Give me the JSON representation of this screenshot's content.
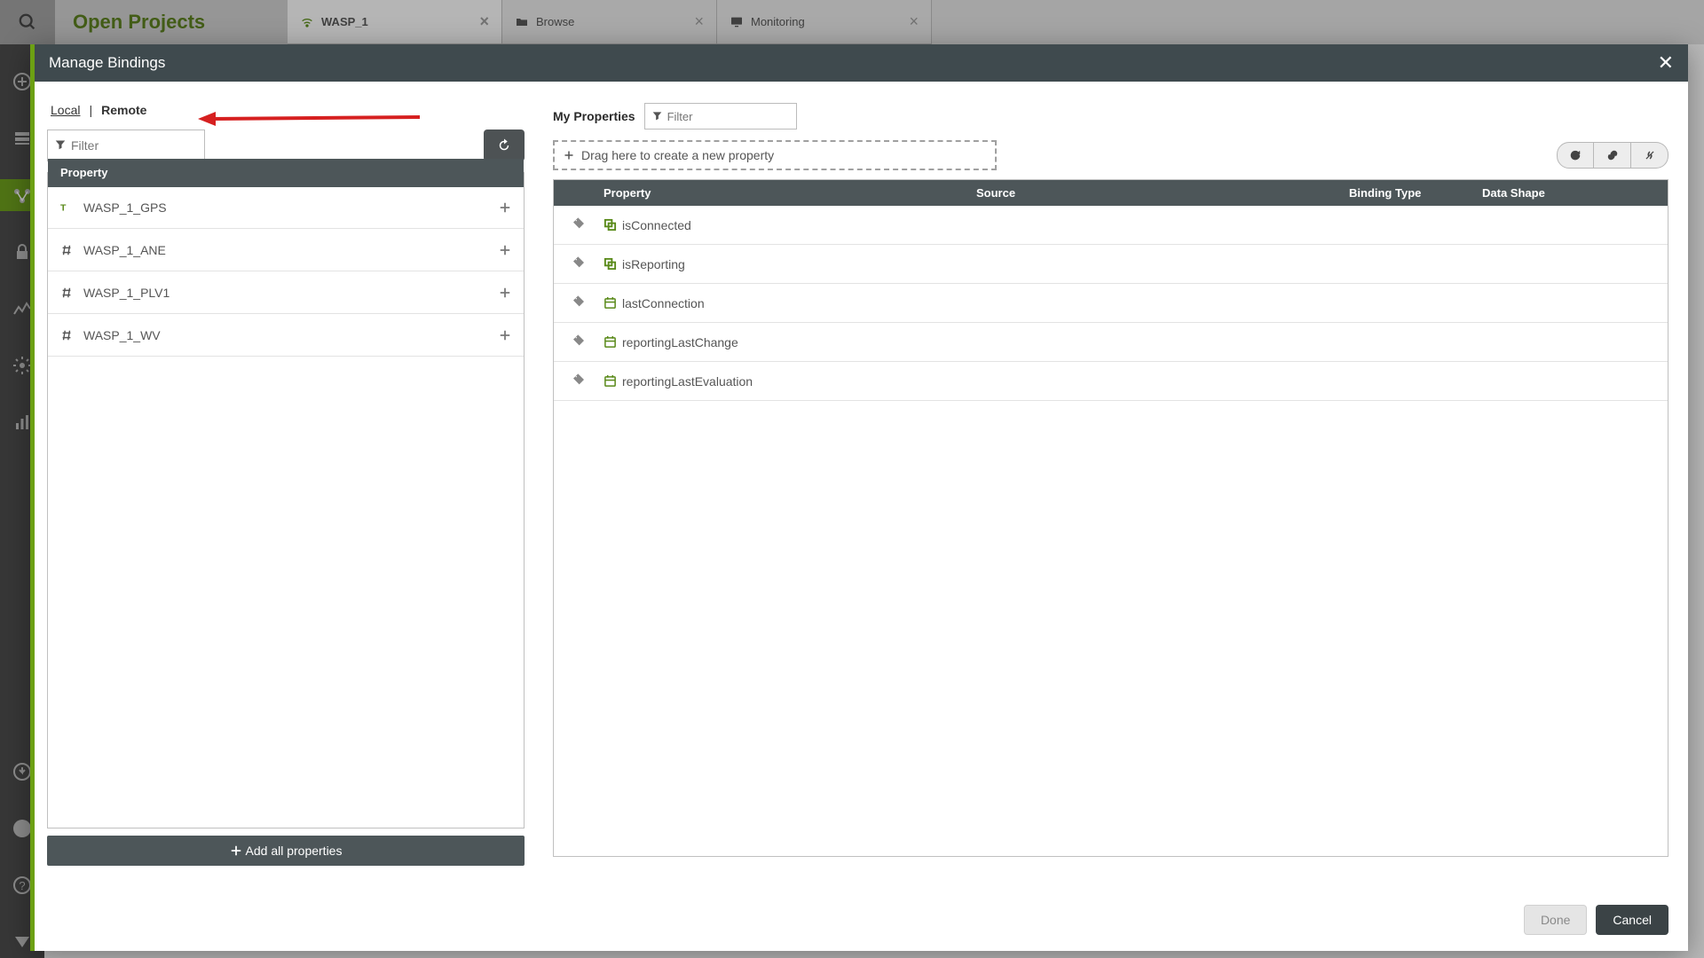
{
  "background": {
    "open_projects_label": "Open Projects",
    "tabs": [
      {
        "label": "WASP_1",
        "icon": "wifi",
        "active": true
      },
      {
        "label": "Browse",
        "icon": "folder",
        "active": false
      },
      {
        "label": "Monitoring",
        "icon": "monitor",
        "active": false
      }
    ]
  },
  "modal": {
    "title": "Manage Bindings",
    "left": {
      "tabs": {
        "local": "Local",
        "remote": "Remote"
      },
      "filter_placeholder": "Filter",
      "header_property": "Property",
      "properties": [
        {
          "name": "WASP_1_GPS",
          "type": "text"
        },
        {
          "name": "WASP_1_ANE",
          "type": "number"
        },
        {
          "name": "WASP_1_PLV1",
          "type": "number"
        },
        {
          "name": "WASP_1_WV",
          "type": "number"
        }
      ],
      "add_all_label": "Add all properties"
    },
    "right": {
      "my_properties_label": "My Properties",
      "filter_placeholder": "Filter",
      "dropzone_label": "Drag here to create a new property",
      "headers": {
        "property": "Property",
        "source": "Source",
        "binding_type": "Binding Type",
        "data_shape": "Data Shape"
      },
      "rows": [
        {
          "name": "isConnected",
          "type": "boolean"
        },
        {
          "name": "isReporting",
          "type": "boolean"
        },
        {
          "name": "lastConnection",
          "type": "datetime"
        },
        {
          "name": "reportingLastChange",
          "type": "datetime"
        },
        {
          "name": "reportingLastEvaluation",
          "type": "datetime"
        }
      ]
    },
    "footer": {
      "done": "Done",
      "cancel": "Cancel"
    }
  }
}
